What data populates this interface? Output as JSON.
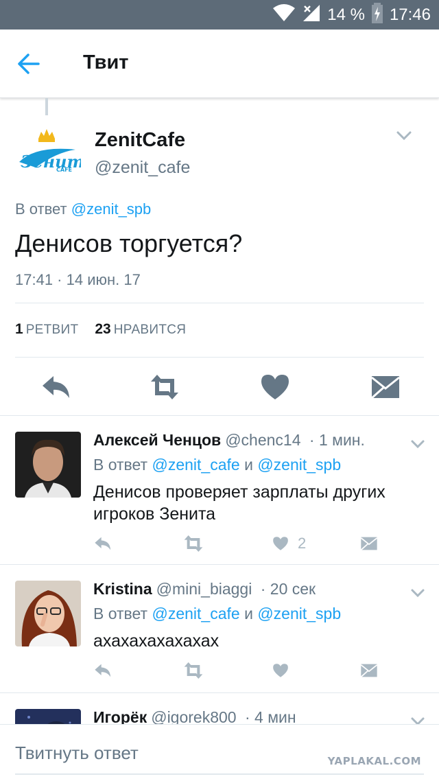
{
  "status_bar": {
    "battery": "14 %",
    "time": "17:46",
    "icons": [
      "wifi-icon",
      "signal-icon",
      "battery-charging-icon"
    ]
  },
  "header": {
    "title": "Твит",
    "back_icon": "arrow-left-icon"
  },
  "main_tweet": {
    "name": "ZenitCafe",
    "handle": "@zenit_cafe",
    "avatar_logo_text": "Зенит CAFE",
    "reply_prefix": "В ответ",
    "reply_to": "@zenit_spb",
    "text": "Денисов торгуется?",
    "timestamp": "17:41 · 14 июн. 17",
    "retweets": {
      "count": "1",
      "label": "РЕТВИТ"
    },
    "likes": {
      "count": "23",
      "label": "НРАВИТСЯ"
    },
    "actions": [
      "reply-icon",
      "retweet-icon",
      "heart-icon",
      "message-icon"
    ]
  },
  "replies": [
    {
      "name": "Алексей Ченцов",
      "handle": "@chenc14",
      "time": "· 1 мин.",
      "reply_prefix": "В ответ",
      "reply_to_1": "@zenit_cafe",
      "conj": "и",
      "reply_to_2": "@zenit_spb",
      "text": "Денисов проверяет зарплаты других игроков Зенита",
      "like_count": "2"
    },
    {
      "name": "Kristina",
      "handle": "@mini_biaggi",
      "time": "· 20 сек",
      "reply_prefix": "В ответ",
      "reply_to_1": "@zenit_cafe",
      "conj": "и",
      "reply_to_2": "@zenit_spb",
      "text": "ахахахахахахах",
      "like_count": ""
    },
    {
      "name": "Игорёк",
      "handle": "@igorek800",
      "time": "· 4 мин",
      "reply_prefix": "",
      "reply_to_1": "",
      "conj": "",
      "reply_to_2": "",
      "text": "",
      "like_count": ""
    }
  ],
  "compose": {
    "placeholder": "Твитнуть ответ",
    "watermark": "YAPLAKAL.COM"
  },
  "colors": {
    "accent": "#1da1f2",
    "secondary_text": "#657786",
    "action_icon_main": "#657786",
    "action_icon_reply": "#aab8c2",
    "status_bar": "#5d6b78"
  }
}
